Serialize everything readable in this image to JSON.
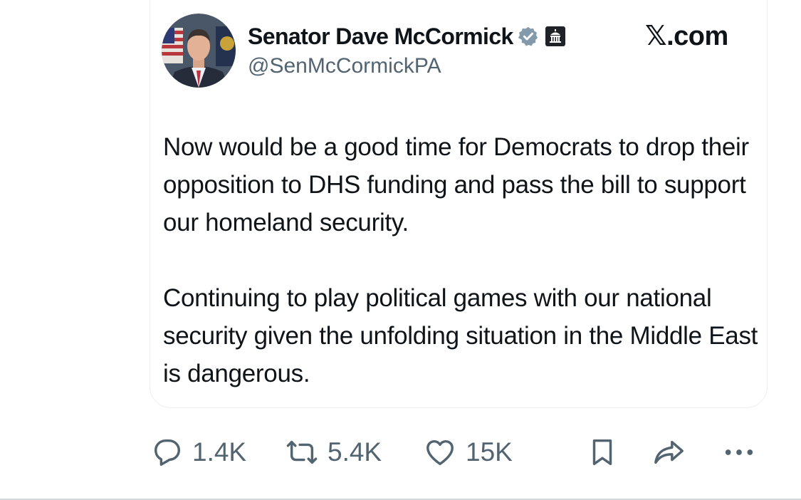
{
  "author": {
    "display_name": "Senator Dave McCormick",
    "handle": "@SenMcCormickPA",
    "verified_icon": "verified-badge-icon",
    "affiliation_icon": "government-building-icon"
  },
  "platform": {
    "label": "𝕏.com"
  },
  "tweet": {
    "paragraph_1": "Now would be a good time for Democrats to drop their opposition to DHS funding and pass the bill to support our homeland security.",
    "paragraph_2": "Continuing to play political games with our national security given the unfolding situation in the Middle East is dangerous."
  },
  "actions": {
    "replies": "1.4K",
    "reposts": "5.4K",
    "likes": "15K",
    "icons": [
      "reply-icon",
      "repost-icon",
      "like-icon",
      "bookmark-icon",
      "share-icon",
      "more-icon"
    ]
  },
  "colors": {
    "text_primary": "#0f1419",
    "text_secondary": "#536471",
    "verified_badge": "#829aab"
  }
}
